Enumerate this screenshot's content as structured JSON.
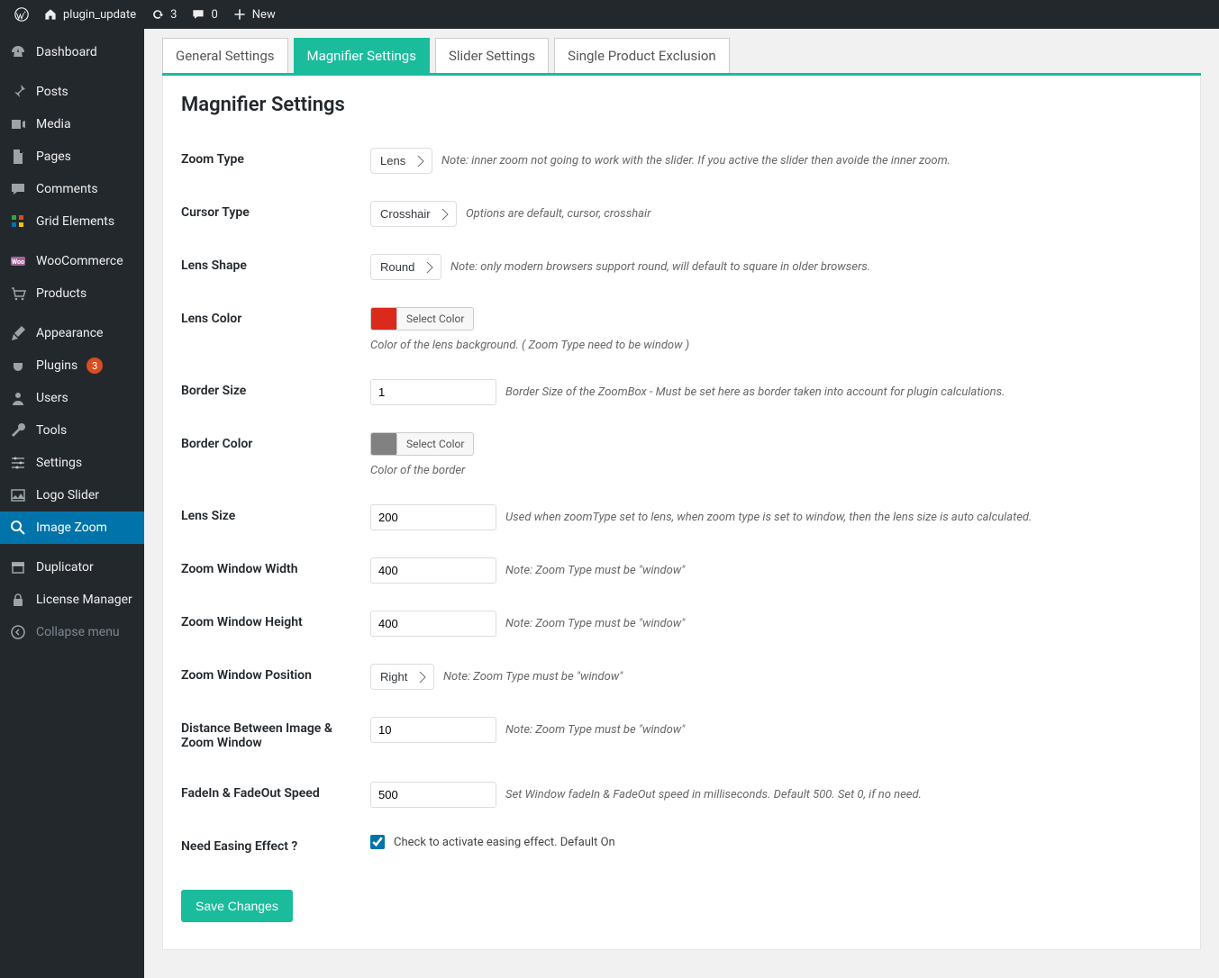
{
  "adminbar": {
    "site_name": "plugin_update",
    "updates_count": "3",
    "comments_count": "0",
    "new_label": "New"
  },
  "sidebar": {
    "items": [
      {
        "label": "Dashboard"
      },
      {
        "label": "Posts"
      },
      {
        "label": "Media"
      },
      {
        "label": "Pages"
      },
      {
        "label": "Comments"
      },
      {
        "label": "Grid Elements"
      },
      {
        "label": "WooCommerce"
      },
      {
        "label": "Products"
      },
      {
        "label": "Appearance"
      },
      {
        "label": "Plugins",
        "badge": "3"
      },
      {
        "label": "Users"
      },
      {
        "label": "Tools"
      },
      {
        "label": "Settings"
      },
      {
        "label": "Logo Slider"
      },
      {
        "label": "Image Zoom"
      },
      {
        "label": "Duplicator"
      },
      {
        "label": "License Manager"
      }
    ],
    "collapse_label": "Collapse menu"
  },
  "tabs": {
    "general": "General Settings",
    "magnifier": "Magnifier Settings",
    "slider": "Slider Settings",
    "exclusion": "Single Product Exclusion"
  },
  "page": {
    "title": "Magnifier Settings"
  },
  "fields": {
    "zoom_type": {
      "label": "Zoom Type",
      "value": "Lens",
      "note": "Note: inner zoom not going to work with the slider. If you active the slider then avoide the inner zoom."
    },
    "cursor_type": {
      "label": "Cursor Type",
      "value": "Crosshair",
      "note": "Options are default, cursor, crosshair"
    },
    "lens_shape": {
      "label": "Lens Shape",
      "value": "Round",
      "note": "Note: only modern browsers support round, will default to square in older browsers."
    },
    "lens_color": {
      "label": "Lens Color",
      "btn": "Select Color",
      "swatch": "#d92a1c",
      "note": "Color of the lens background. ( Zoom Type need to be window )"
    },
    "border_size": {
      "label": "Border Size",
      "value": "1",
      "note": "Border Size of the ZoomBox - Must be set here as border taken into account for plugin calculations."
    },
    "border_color": {
      "label": "Border Color",
      "btn": "Select Color",
      "swatch": "#818181",
      "note": "Color of the border"
    },
    "lens_size": {
      "label": "Lens Size",
      "value": "200",
      "note": "Used when zoomType set to lens, when zoom type is set to window, then the lens size is auto calculated."
    },
    "window_width": {
      "label": "Zoom Window Width",
      "value": "400",
      "note": "Note: Zoom Type must be \"window\""
    },
    "window_height": {
      "label": "Zoom Window Height",
      "value": "400",
      "note": "Note: Zoom Type must be \"window\""
    },
    "window_pos": {
      "label": "Zoom Window Position",
      "value": "Right",
      "note": "Note: Zoom Type must be \"window\""
    },
    "distance": {
      "label": "Distance Between Image & Zoom Window",
      "value": "10",
      "note": "Note: Zoom Type must be \"window\""
    },
    "fade": {
      "label": "FadeIn & FadeOut Speed",
      "value": "500",
      "note": "Set Window fadeIn & FadeOut speed in milliseconds. Default 500. Set 0, if no need."
    },
    "easing": {
      "label": "Need Easing Effect ?",
      "checked": true,
      "note": "Check to activate easing effect. Default On"
    }
  },
  "buttons": {
    "save": "Save Changes"
  }
}
